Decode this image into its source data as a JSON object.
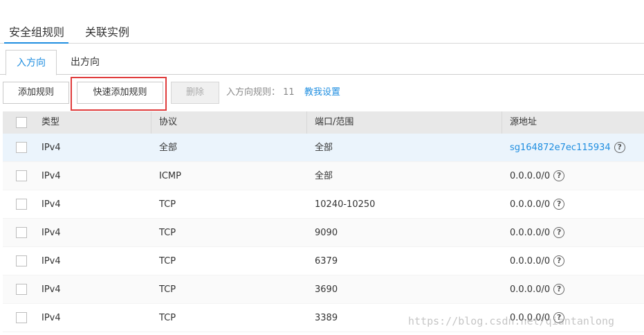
{
  "top_tabs": [
    {
      "label": "安全组规则",
      "active": true
    },
    {
      "label": "关联实例",
      "active": false
    }
  ],
  "sub_tabs": [
    {
      "label": "入方向",
      "active": true
    },
    {
      "label": "出方向",
      "active": false
    }
  ],
  "toolbar": {
    "add_label": "添加规则",
    "quick_add_label": "快速添加规则",
    "delete_label": "删除",
    "rule_count_text": "入方向规则： 11",
    "help_link": "教我设置"
  },
  "table": {
    "headers": [
      "类型",
      "协议",
      "端口/范围",
      "源地址"
    ],
    "rows": [
      {
        "type": "IPv4",
        "protocol": "全部",
        "port": "全部",
        "source": "sg164872e7ec115934",
        "source_is_link": true
      },
      {
        "type": "IPv4",
        "protocol": "ICMP",
        "port": "全部",
        "source": "0.0.0.0/0",
        "source_is_link": false
      },
      {
        "type": "IPv4",
        "protocol": "TCP",
        "port": "10240-10250",
        "source": "0.0.0.0/0",
        "source_is_link": false
      },
      {
        "type": "IPv4",
        "protocol": "TCP",
        "port": "9090",
        "source": "0.0.0.0/0",
        "source_is_link": false
      },
      {
        "type": "IPv4",
        "protocol": "TCP",
        "port": "6379",
        "source": "0.0.0.0/0",
        "source_is_link": false
      },
      {
        "type": "IPv4",
        "protocol": "TCP",
        "port": "3690",
        "source": "0.0.0.0/0",
        "source_is_link": false
      },
      {
        "type": "IPv4",
        "protocol": "TCP",
        "port": "3389",
        "source": "0.0.0.0/0",
        "source_is_link": false
      }
    ]
  },
  "help_icon": "question-circle-icon",
  "watermark": "https://blog.csdn.net/qiantanlong",
  "colors": {
    "accent": "#1f8ee0",
    "highlight_box": "#e03c3c",
    "header_bg": "#e8e8e8",
    "selected_row_bg": "#ebf4fc"
  }
}
